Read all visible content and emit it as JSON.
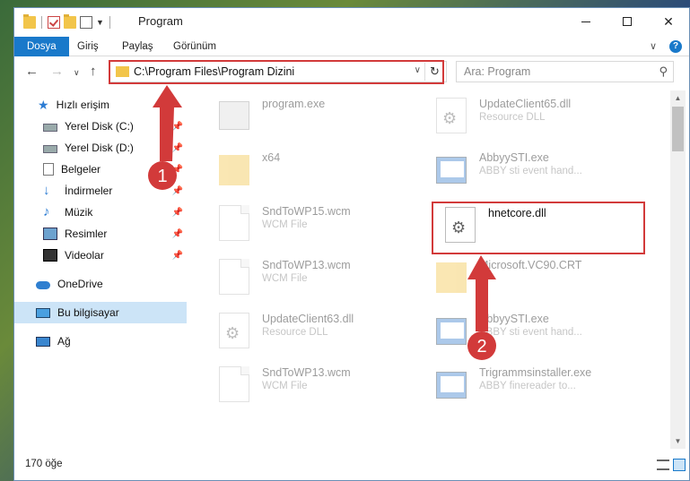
{
  "window": {
    "title": "Program"
  },
  "ribbon": {
    "tabs": [
      {
        "label": "Dosya",
        "active": true
      },
      {
        "label": "Giriş"
      },
      {
        "label": "Paylaş"
      },
      {
        "label": "Görünüm"
      }
    ]
  },
  "address": {
    "path": "C:\\Program Files\\Program Dizini"
  },
  "search": {
    "placeholder": "Ara: Program"
  },
  "sidebar": {
    "items": [
      {
        "label": "Hızlı erişim",
        "icon": "star-icon"
      },
      {
        "label": "Yerel Disk (C:)",
        "icon": "disk-icon",
        "pinned": true
      },
      {
        "label": "Yerel Disk (D:)",
        "icon": "disk-icon",
        "pinned": true
      },
      {
        "label": "Belgeler",
        "icon": "documents-icon",
        "pinned": true
      },
      {
        "label": "İndirmeler",
        "icon": "download-icon",
        "pinned": true
      },
      {
        "label": "Müzik",
        "icon": "music-icon",
        "pinned": true
      },
      {
        "label": "Resimler",
        "icon": "pictures-icon",
        "pinned": true
      },
      {
        "label": "Videolar",
        "icon": "videos-icon",
        "pinned": true
      },
      {
        "label": "OneDrive",
        "icon": "cloud-icon"
      },
      {
        "label": "Bu bilgisayar",
        "icon": "computer-icon",
        "selected": true
      },
      {
        "label": "Ağ",
        "icon": "network-icon"
      }
    ]
  },
  "files": [
    {
      "name": "program.exe",
      "desc": ""
    },
    {
      "name": "UpdateClient65.dll",
      "desc": "Resource DLL"
    },
    {
      "name": "x64",
      "desc": ""
    },
    {
      "name": "AbbyySTI.exe",
      "desc": "ABBY sti event hand..."
    },
    {
      "name": "SndToWP15.wcm",
      "desc": "WCM File"
    },
    {
      "name": "hnetcore.dll",
      "desc": ""
    },
    {
      "name": "SndToWP13.wcm",
      "desc": "WCM File"
    },
    {
      "name": "Microsoft.VC90.CRT",
      "desc": ""
    },
    {
      "name": "UpdateClient63.dll",
      "desc": "Resource DLL"
    },
    {
      "name": "AbbyySTI.exe",
      "desc": "ABBY sti event hand..."
    },
    {
      "name": "SndToWP13.wcm",
      "desc": "WCM File"
    },
    {
      "name": "Trigrammsinstaller.exe",
      "desc": "ABBY finereader to..."
    }
  ],
  "status": {
    "count": "170 öğe"
  },
  "annotations": {
    "step1": "1",
    "step2": "2",
    "color": "#d23a3a"
  }
}
